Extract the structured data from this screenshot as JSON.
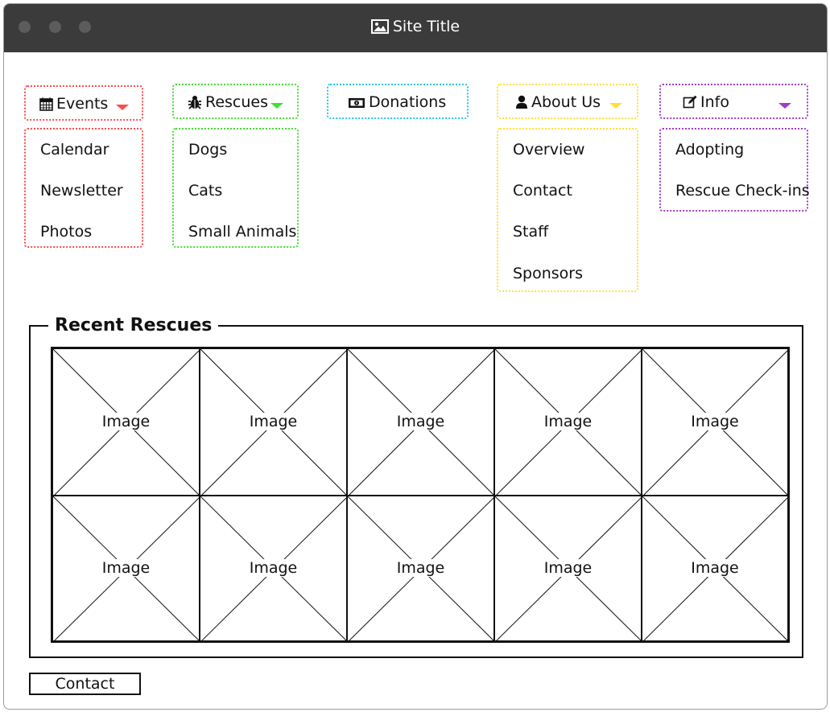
{
  "window": {
    "title": "Site Title"
  },
  "colors": {
    "events": "#ff4b4b",
    "rescues": "#44dd33",
    "donations": "#22c8e0",
    "about": "#ffe03a",
    "info": "#a43cc8"
  },
  "nav": {
    "events": {
      "label": "Events",
      "icon": "calendar-icon",
      "items": [
        "Calendar",
        "Newsletter",
        "Photos"
      ]
    },
    "rescues": {
      "label": "Rescues",
      "icon": "bug-icon",
      "items": [
        "Dogs",
        "Cats",
        "Small Animals"
      ]
    },
    "donations": {
      "label": "Donations",
      "icon": "money-icon"
    },
    "about": {
      "label": "About Us",
      "icon": "user-icon",
      "items": [
        "Overview",
        "Contact",
        "Staff",
        "Sponsors"
      ]
    },
    "info": {
      "label": "Info",
      "icon": "edit-icon",
      "items": [
        "Adopting",
        "Rescue Check-ins"
      ]
    }
  },
  "recent": {
    "title": "Recent Rescues",
    "images": [
      "Image",
      "Image",
      "Image",
      "Image",
      "Image",
      "Image",
      "Image",
      "Image",
      "Image",
      "Image"
    ]
  },
  "footer": {
    "contact_label": "Contact"
  }
}
